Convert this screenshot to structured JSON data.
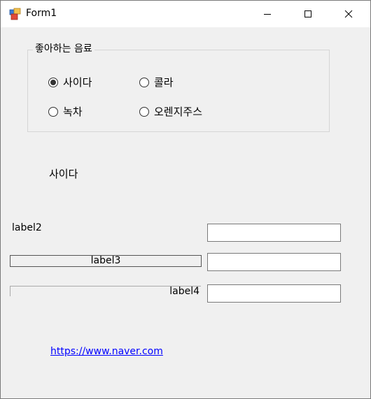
{
  "window": {
    "title": "Form1",
    "icon": "winforms-app-icon",
    "controls": {
      "minimize": "minimize-icon",
      "maximize": "maximize-icon",
      "close": "close-icon"
    }
  },
  "group": {
    "caption": "좋아하는 음료",
    "options": [
      {
        "label": "사이다",
        "checked": true
      },
      {
        "label": "콜라",
        "checked": false
      },
      {
        "label": "녹차",
        "checked": false
      },
      {
        "label": "오렌지주스",
        "checked": false
      }
    ]
  },
  "selected_label": "사이다",
  "labels": {
    "label2": "label2",
    "label3": "label3",
    "label4": "label4"
  },
  "textboxes": [
    {
      "value": ""
    },
    {
      "value": ""
    },
    {
      "value": ""
    }
  ],
  "link": {
    "text": "https://www.naver.com"
  },
  "colors": {
    "link": "#0000ff",
    "client_bg": "#f0f0f0"
  }
}
